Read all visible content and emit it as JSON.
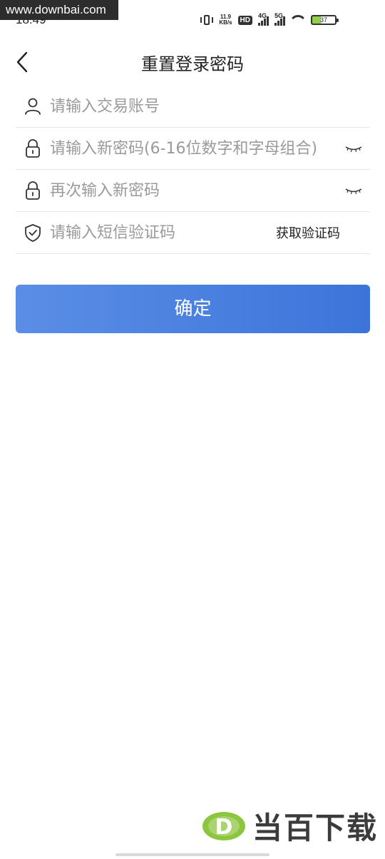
{
  "watermark": {
    "text": "www.downbai.com"
  },
  "status_bar": {
    "time": "18:49",
    "speed_value": "11.9",
    "speed_unit": "KB/s",
    "hd_label": "HD",
    "signal_4g": "4G",
    "signal_5g": "5G",
    "battery": "37",
    "battery_color": "#8fd14f"
  },
  "header": {
    "back_icon": "chevron-left-icon",
    "title": "重置登录密码"
  },
  "form": {
    "account_placeholder": "请输入交易账号",
    "account_icon": "user-icon",
    "new_password_placeholder": "请输入新密码(6-16位数字和字母组合)",
    "new_password_icon": "lock-icon",
    "confirm_password_placeholder": "再次输入新密码",
    "confirm_password_icon": "lock-icon",
    "sms_code_placeholder": "请输入短信验证码",
    "sms_code_icon": "shield-check-icon",
    "get_code_label": "获取验证码",
    "eye_icon": "eye-closed-icon"
  },
  "confirm_button": {
    "label": "确定",
    "color": "#4a82e0"
  },
  "brand": {
    "text": "当百下载",
    "logo_letter": "D",
    "logo_color": "#8cc63f"
  }
}
